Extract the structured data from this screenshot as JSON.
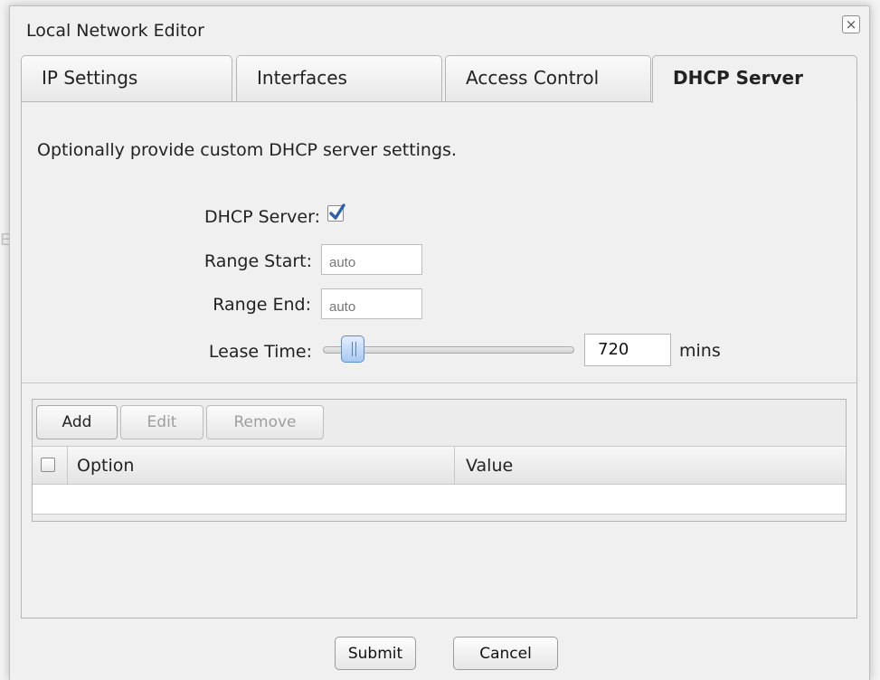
{
  "dialog": {
    "title": "Local Network Editor",
    "close_glyph": "×"
  },
  "tabs": [
    {
      "label": "IP Settings",
      "active": false
    },
    {
      "label": "Interfaces",
      "active": false
    },
    {
      "label": "Access Control",
      "active": false
    },
    {
      "label": "DHCP Server",
      "active": true
    }
  ],
  "dhcp": {
    "intro": "Optionally provide custom DHCP server settings.",
    "server_label": "DHCP Server:",
    "server_enabled": true,
    "range_start_label": "Range Start:",
    "range_start_placeholder": "auto",
    "range_end_label": "Range End:",
    "range_end_placeholder": "auto",
    "lease_time_label": "Lease Time:",
    "lease_time_value": "720",
    "lease_time_unit": "mins",
    "lease_slider_fraction": 0.08
  },
  "options_grid": {
    "add_label": "Add",
    "edit_label": "Edit",
    "remove_label": "Remove",
    "columns": [
      "Option",
      "Value"
    ],
    "rows": []
  },
  "footer": {
    "submit_label": "Submit",
    "cancel_label": "Cancel"
  },
  "colors": {
    "accent": "#3a6fc4",
    "dialog_bg": "#f0f0f0",
    "border": "#b5b5b5"
  },
  "icons": {
    "close": "close-icon",
    "checkbox_checked": "checkmark-icon"
  }
}
